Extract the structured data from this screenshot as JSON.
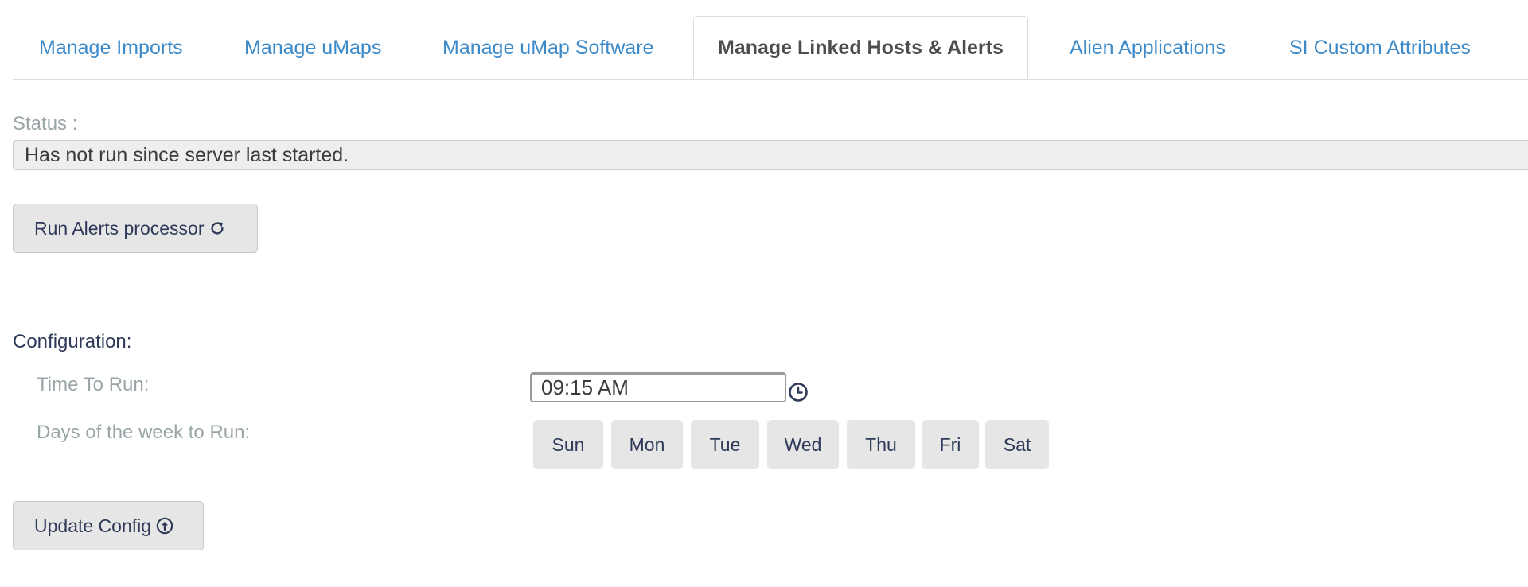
{
  "tabs": [
    {
      "label": "Manage Imports"
    },
    {
      "label": "Manage uMaps"
    },
    {
      "label": "Manage uMap Software"
    },
    {
      "label": "Manage Linked Hosts & Alerts",
      "active": true
    },
    {
      "label": "Alien Applications"
    },
    {
      "label": "SI Custom Attributes"
    }
  ],
  "status": {
    "label": "Status :",
    "value": "Has not run since server last started."
  },
  "run_button": {
    "label": "Run Alerts processor",
    "icon": "refresh-icon"
  },
  "configuration": {
    "title": "Configuration:",
    "time_label": "Time To Run:",
    "time_value": "09:15 AM",
    "time_icon": "clock-icon",
    "days_label": "Days of the week to Run:",
    "days": [
      "Sun",
      "Mon",
      "Tue",
      "Wed",
      "Thu",
      "Fri",
      "Sat"
    ]
  },
  "update_button": {
    "label": "Update Config",
    "icon": "upload-circle-icon"
  },
  "colors": {
    "link": "#3d8ac9",
    "active_tab_text": "#4d4d4d",
    "muted_label": "#9aa5a8",
    "button_bg": "#e6e6e6",
    "text_dark": "#2f3a5a"
  }
}
